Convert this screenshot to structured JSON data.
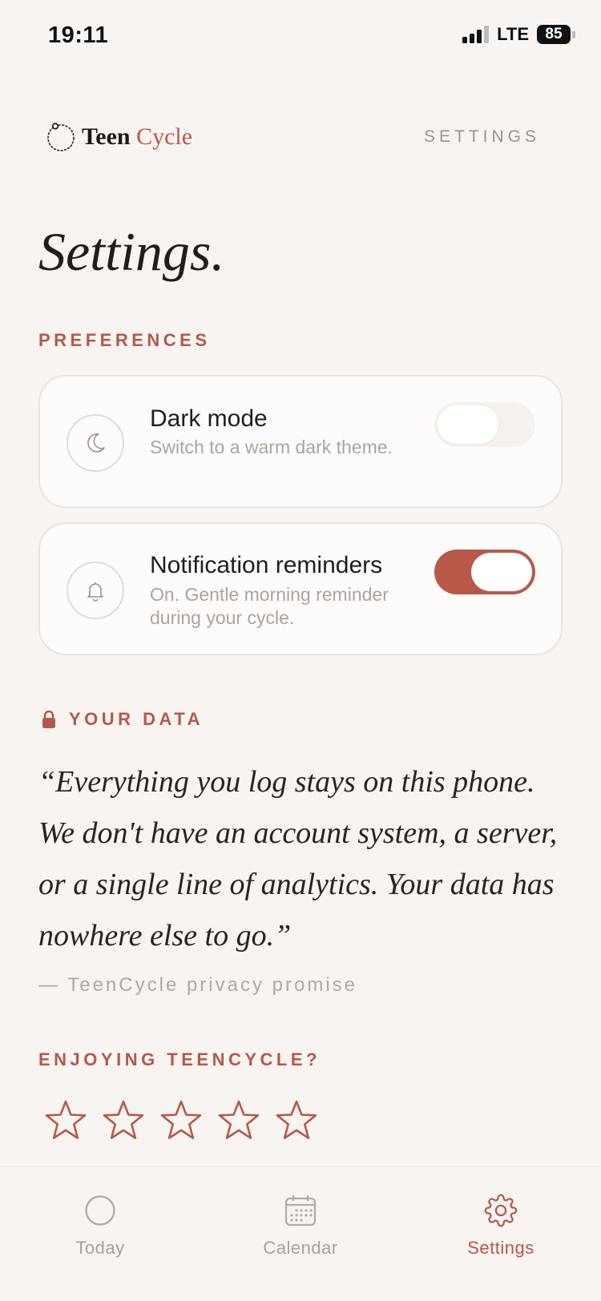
{
  "status_bar": {
    "time": "19:11",
    "network": "LTE",
    "battery": "85"
  },
  "header": {
    "app_name_part1": "Teen",
    "app_name_part2": "Cycle",
    "section": "SETTINGS"
  },
  "page": {
    "title": "Settings."
  },
  "preferences": {
    "label": "PREFERENCES",
    "items": [
      {
        "title": "Dark mode",
        "subtitle": "Switch to a warm dark theme.",
        "enabled": false,
        "icon": "moon-icon"
      },
      {
        "title": "Notification reminders",
        "subtitle": "On. Gentle morning reminder during your cycle.",
        "enabled": true,
        "icon": "bell-icon"
      }
    ]
  },
  "your_data": {
    "label": "YOUR DATA",
    "icon": "lock-icon",
    "quote": "“Everything you log stays on this phone. We don't have an account system, a server, or a single line of analytics. Your data has nowhere else to go.”",
    "attribution": "— TeenCycle privacy promise"
  },
  "rating": {
    "label": "ENJOYING TEENCYCLE?",
    "rating": 0,
    "max": 5
  },
  "bottom_nav": {
    "items": [
      {
        "label": "Today",
        "icon": "circle-icon",
        "active": false
      },
      {
        "label": "Calendar",
        "icon": "calendar-icon",
        "active": false
      },
      {
        "label": "Settings",
        "icon": "gear-icon",
        "active": true
      }
    ]
  },
  "colors": {
    "accent": "#b9594a",
    "background": "#f8f4f1",
    "card": "#fefcfa",
    "muted_text": "#ada39e"
  }
}
